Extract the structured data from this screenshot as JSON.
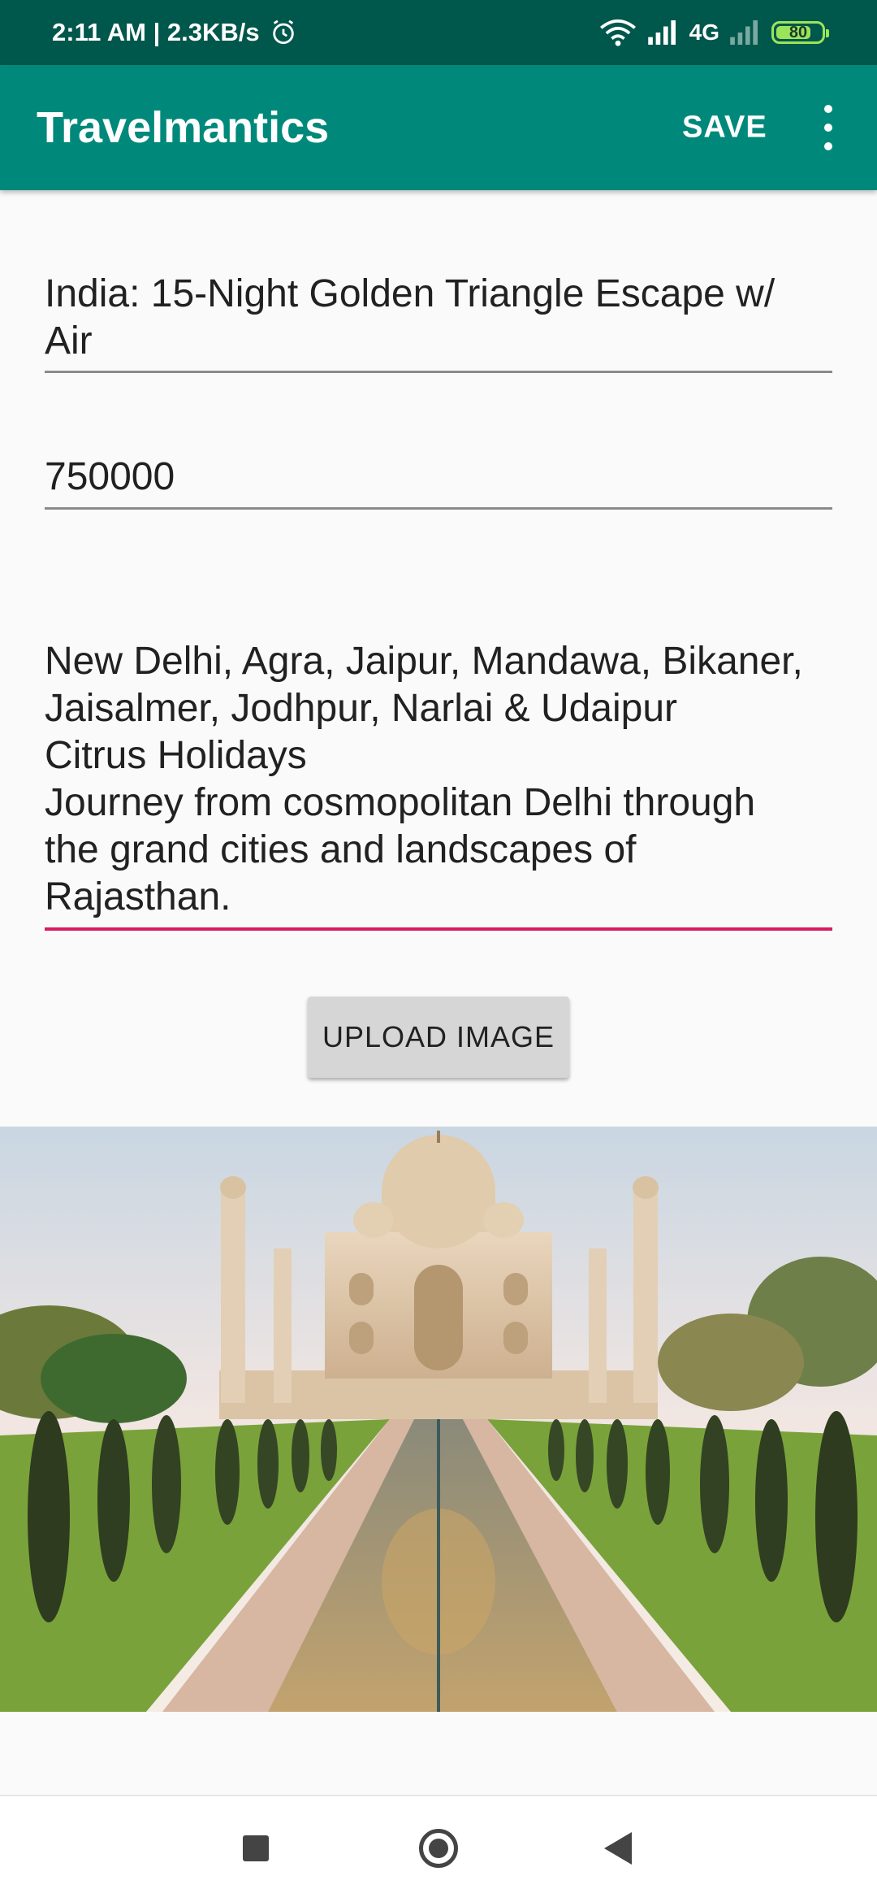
{
  "status_bar": {
    "time": "2:11 AM | 2.3KB/s",
    "network": "4G",
    "battery": "80",
    "battery_level": 0.8
  },
  "app_bar": {
    "title": "Travelmantics",
    "save_label": "SAVE",
    "overflow_icon": "more-vert-icon"
  },
  "form": {
    "title_value": "India: 15-Night Golden Triangle Escape w/\nAir",
    "price_value": "750000",
    "description_value": "New Delhi, Agra, Jaipur, Mandawa, Bikaner,\nJaisalmer, Jodhpur, Narlai & Udaipur\nCitrus Holidays\nJourney from cosmopolitan Delhi through\nthe grand cities and landscapes of\nRajasthan."
  },
  "upload_button_label": "UPLOAD IMAGE",
  "colors": {
    "status_bar": "#00574b",
    "app_bar": "#00897b",
    "accent": "#d81b60"
  },
  "nav": {
    "recents_icon": "square-icon",
    "home_icon": "circle-icon",
    "back_icon": "triangle-back-icon"
  }
}
